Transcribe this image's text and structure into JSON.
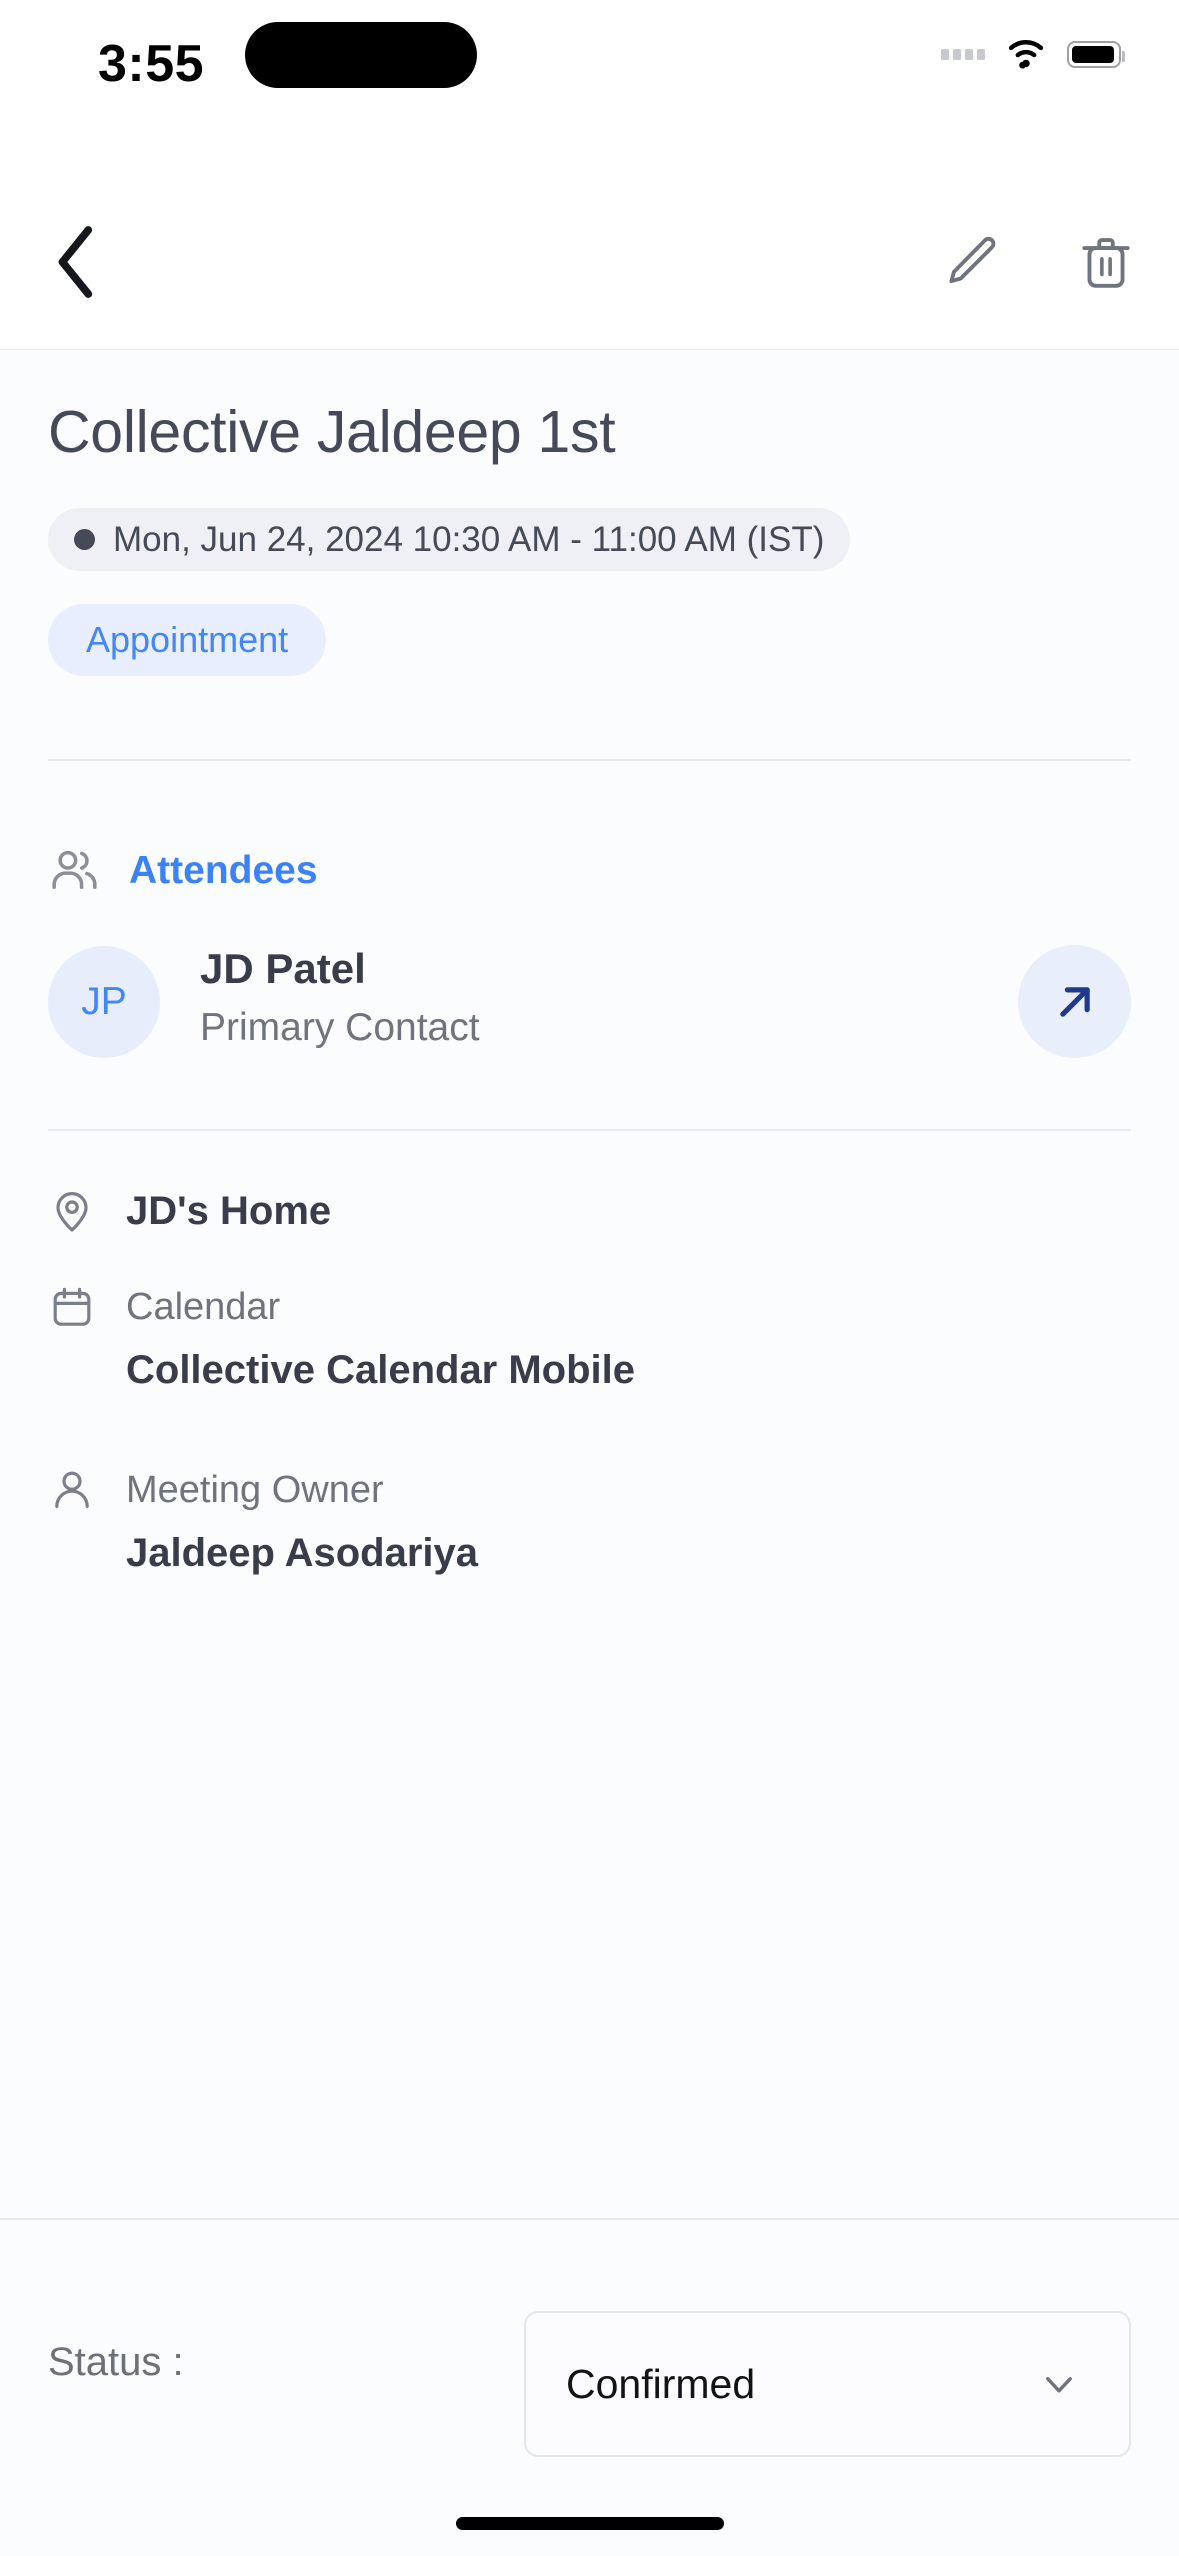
{
  "status_bar": {
    "time": "3:55",
    "signal_icon": "signal-dots-icon",
    "wifi_icon": "wifi-icon",
    "battery_icon": "battery-full-icon"
  },
  "nav_bar": {
    "back_icon": "chevron-left-icon",
    "edit_icon": "pencil-icon",
    "delete_icon": "trash-icon"
  },
  "event": {
    "title": "Collective Jaldeep 1st",
    "datetime": "Mon, Jun 24, 2024 10:30 AM - 11:00 AM (IST)",
    "type_badge": "Appointment"
  },
  "attendees": {
    "section_icon": "users-icon",
    "section_label": "Attendees",
    "list": [
      {
        "initials": "JP",
        "name": "JD Patel",
        "role": "Primary Contact",
        "open_icon": "arrow-up-right-icon"
      }
    ]
  },
  "details": {
    "location": {
      "icon": "map-pin-icon",
      "value": "JD's Home"
    },
    "calendar": {
      "icon": "calendar-icon",
      "label": "Calendar",
      "value": "Collective Calendar Mobile"
    },
    "owner": {
      "icon": "user-icon",
      "label": "Meeting Owner",
      "value": "Jaldeep Asodariya"
    }
  },
  "footer": {
    "status_label": "Status :",
    "status_value": "Confirmed",
    "status_chevron_icon": "chevron-down-icon"
  },
  "colors": {
    "accent_blue": "#4287f5",
    "attendees_blue": "#3b82f6",
    "arrow_navy": "#1f3a8a",
    "text_dark": "#383d49",
    "text_muted": "#6f737e",
    "page_bg": "#fbfcfe",
    "chip_bg": "#eff0f5",
    "badge_bg": "#e8eefd"
  }
}
